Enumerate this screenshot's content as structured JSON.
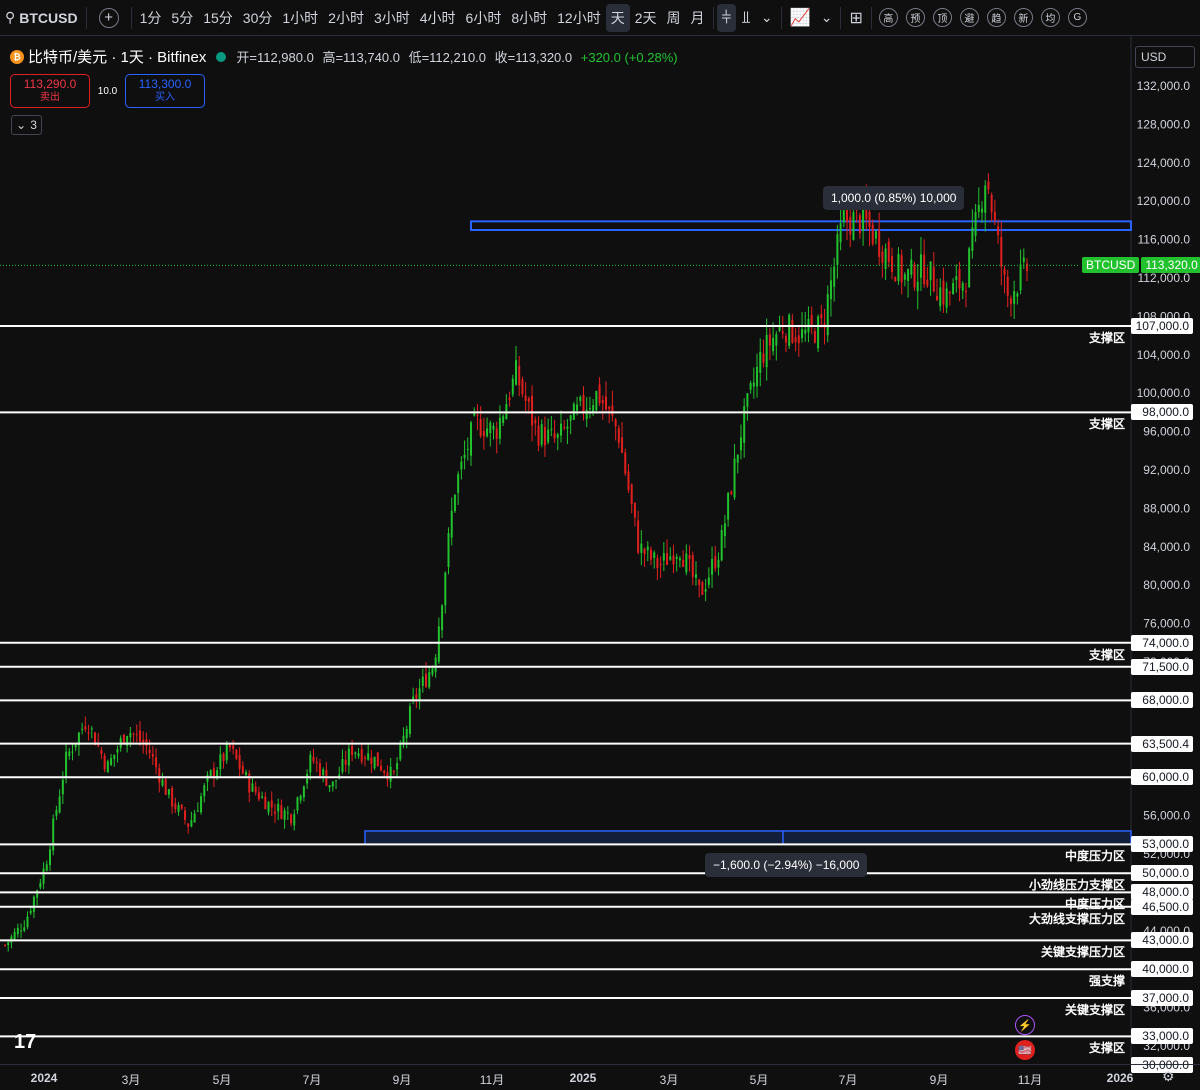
{
  "toolbar": {
    "symbol": "BTCUSD",
    "intervals": [
      "1分",
      "5分",
      "15分",
      "30分",
      "1小时",
      "2小时",
      "3小时",
      "4小时",
      "6小时",
      "8小时",
      "12小时",
      "天",
      "2天",
      "周",
      "月"
    ],
    "active_interval": "天",
    "indicator_tags": [
      "高",
      "预",
      "顶",
      "避",
      "趋",
      "新",
      "均",
      "G"
    ]
  },
  "legend": {
    "title": "比特币/美元 · 1天 · Bitfinex",
    "open_label": "开=112,980.0",
    "high_label": "高=113,740.0",
    "low_label": "低=112,210.0",
    "close_label": "收=113,320.0",
    "change_label": "+320.0 (+0.28%)"
  },
  "trade": {
    "sell_price": "113,290.0",
    "sell_label": "卖出",
    "spread": "10.0",
    "buy_price": "113,300.0",
    "buy_label": "买入"
  },
  "collapse_count": "3",
  "currency": "USD",
  "colors": {
    "up": "#22c22e",
    "down": "#e0201f",
    "line": "#ffffff",
    "blue": "#2962ff",
    "bg": "#0f0f0f"
  },
  "y_axis": {
    "labels": [
      "132,000.0",
      "128,000.0",
      "124,000.0",
      "120,000.0",
      "116,000.0",
      "112,000.0",
      "108,000.0",
      "104,000.0",
      "100,000.0",
      "96,000.0",
      "92,000.0",
      "88,000.0",
      "84,000.0",
      "80,000.0",
      "76,000.0",
      "72,000.0",
      "56,000.0",
      "52,000.0",
      "44,000.0",
      "36,000.0",
      "32,000.0"
    ]
  },
  "x_axis": {
    "labels": [
      "2024",
      "3月",
      "5月",
      "7月",
      "9月",
      "11月",
      "2025",
      "3月",
      "5月",
      "7月",
      "9月",
      "11月",
      "2026"
    ]
  },
  "current_price": {
    "symbol": "BTCUSD",
    "value": "113,320.0"
  },
  "level_lines": [
    {
      "price": "107,000.0",
      "label": "支撑区"
    },
    {
      "price": "98,000.0",
      "label": "支撑区"
    },
    {
      "price": "74,000.0",
      "label": "支撑区"
    },
    {
      "price": "71,500.0",
      "label": ""
    },
    {
      "price": "68,000.0",
      "label": ""
    },
    {
      "price": "63,500.4",
      "label": ""
    },
    {
      "price": "60,000.0",
      "label": ""
    },
    {
      "price": "53,000.0",
      "label": "中度压力区"
    },
    {
      "price": "50,000.0",
      "label": "小劲线压力支撑区"
    },
    {
      "price": "48,000.0",
      "label": "中度压力区"
    },
    {
      "price": "46,500.0",
      "label": "大劲线支撑压力区"
    },
    {
      "price": "43,000.0",
      "label": "关键支撑压力区"
    },
    {
      "price": "40,000.0",
      "label": "强支撑"
    },
    {
      "price": "37,000.0",
      "label": "关键支撑区"
    },
    {
      "price": "33,000.0",
      "label": "支撑区"
    },
    {
      "price": "30,000.0",
      "label": ""
    }
  ],
  "measure_top": "1,000.0 (0.85%) 10,000",
  "measure_bottom": "−1,600.0 (−2.94%) −16,000",
  "chart_data": {
    "type": "candlestick",
    "x": [
      "2024",
      "3月",
      "5月",
      "7月",
      "9月",
      "11月",
      "2025",
      "3月",
      "5月",
      "7月",
      "9月",
      "11月",
      "2026"
    ],
    "close_path": [
      [
        0,
        42500
      ],
      [
        0.5,
        45000
      ],
      [
        1,
        51000
      ],
      [
        1.5,
        62000
      ],
      [
        2,
        66000
      ],
      [
        2.5,
        61000
      ],
      [
        3,
        65000
      ],
      [
        3.5,
        63000
      ],
      [
        4,
        58000
      ],
      [
        4.5,
        55000
      ],
      [
        5,
        60000
      ],
      [
        5.5,
        63000
      ],
      [
        6,
        59000
      ],
      [
        6.5,
        57000
      ],
      [
        7,
        56000
      ],
      [
        7.5,
        62000
      ],
      [
        8,
        59000
      ],
      [
        8.5,
        63000
      ],
      [
        9,
        62000
      ],
      [
        9.5,
        60000
      ],
      [
        10,
        68000
      ],
      [
        10.5,
        72000
      ],
      [
        11,
        90000
      ],
      [
        11.5,
        97000
      ],
      [
        12,
        96000
      ],
      [
        12.5,
        102000
      ],
      [
        13,
        96000
      ],
      [
        13.5,
        95000
      ],
      [
        14,
        98000
      ],
      [
        14.5,
        100000
      ],
      [
        15,
        96000
      ],
      [
        15.5,
        84000
      ],
      [
        16,
        82000
      ],
      [
        16.5,
        84000
      ],
      [
        17,
        79000
      ],
      [
        17.5,
        84000
      ],
      [
        18,
        96000
      ],
      [
        18.5,
        104000
      ],
      [
        19,
        107000
      ],
      [
        19.5,
        106000
      ],
      [
        20,
        107000
      ],
      [
        20.5,
        118000
      ],
      [
        21,
        118000
      ],
      [
        21.5,
        115000
      ],
      [
        22,
        112000
      ],
      [
        22.5,
        113000
      ],
      [
        23,
        110000
      ],
      [
        23.5,
        112000
      ],
      [
        24,
        123000
      ],
      [
        24.5,
        110000
      ],
      [
        25,
        113000
      ]
    ],
    "ylim": [
      29000,
      135000
    ]
  }
}
